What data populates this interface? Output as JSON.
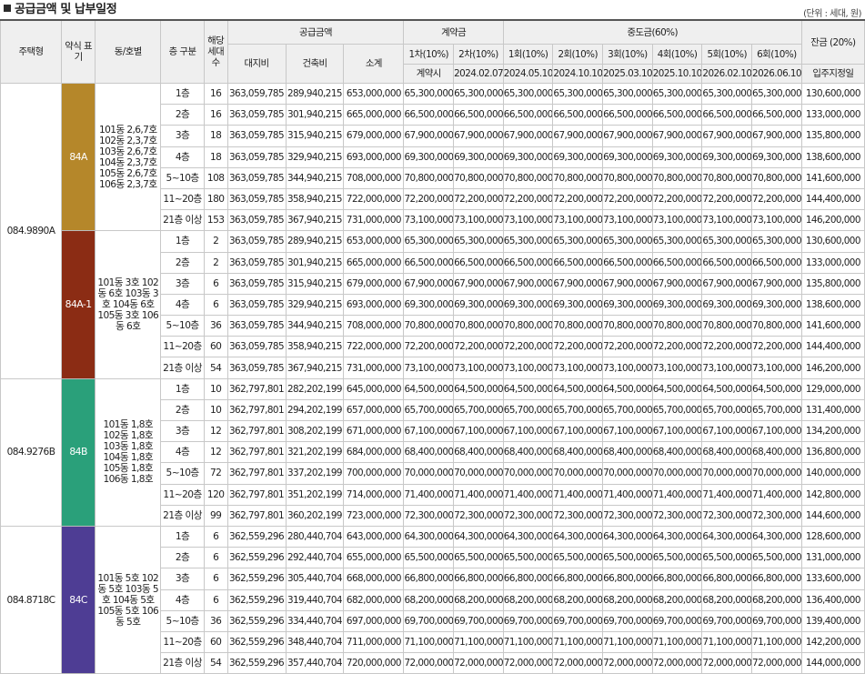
{
  "title": "공급금액 및 납부일정",
  "unit": "(단위 : 세대, 원)",
  "headers": {
    "type": "주택형",
    "abbr": "약식 표기",
    "dong": "동/호별",
    "floor": "층 구분",
    "units": "해당 세대수",
    "supply": "공급금액",
    "land": "대지비",
    "building": "건축비",
    "subtotal": "소계",
    "contract": "계약금",
    "c1": "1차(10%)",
    "c2": "2차(10%)",
    "c1_date": "계약시",
    "c2_date": "2024.02.07",
    "middle": "중도금(60%)",
    "m_labels": [
      "1회(10%)",
      "2회(10%)",
      "3회(10%)",
      "4회(10%)",
      "5회(10%)",
      "6회(10%)"
    ],
    "m_dates": [
      "2024.05.10",
      "2024.10.10",
      "2025.03.10",
      "2025.10.10",
      "2026.02.10",
      "2026.06.10"
    ],
    "balance": "잔금 (20%)",
    "balance_date": "입주지정일"
  },
  "groups": [
    {
      "type": "084.9890A",
      "abbr": "84A",
      "color": "#b5872a",
      "dong": "101동 2,6,7호 102동 2,3,7호 103동 2,6,7호 104동 2,3,7호 105동 2,6,7호 106동 2,3,7호",
      "rows": [
        {
          "floor": "1층",
          "units": "16",
          "land": "363,059,785",
          "building": "289,940,215",
          "subtotal": "653,000,000",
          "c1": "65,300,000",
          "c2": "65,300,000",
          "m": [
            "65,300,000",
            "65,300,000",
            "65,300,000",
            "65,300,000",
            "65,300,000",
            "65,300,000"
          ],
          "balance": "130,600,000"
        },
        {
          "floor": "2층",
          "units": "16",
          "land": "363,059,785",
          "building": "301,940,215",
          "subtotal": "665,000,000",
          "c1": "66,500,000",
          "c2": "66,500,000",
          "m": [
            "66,500,000",
            "66,500,000",
            "66,500,000",
            "66,500,000",
            "66,500,000",
            "66,500,000"
          ],
          "balance": "133,000,000"
        },
        {
          "floor": "3층",
          "units": "18",
          "land": "363,059,785",
          "building": "315,940,215",
          "subtotal": "679,000,000",
          "c1": "67,900,000",
          "c2": "67,900,000",
          "m": [
            "67,900,000",
            "67,900,000",
            "67,900,000",
            "67,900,000",
            "67,900,000",
            "67,900,000"
          ],
          "balance": "135,800,000"
        },
        {
          "floor": "4층",
          "units": "18",
          "land": "363,059,785",
          "building": "329,940,215",
          "subtotal": "693,000,000",
          "c1": "69,300,000",
          "c2": "69,300,000",
          "m": [
            "69,300,000",
            "69,300,000",
            "69,300,000",
            "69,300,000",
            "69,300,000",
            "69,300,000"
          ],
          "balance": "138,600,000"
        },
        {
          "floor": "5~10층",
          "units": "108",
          "land": "363,059,785",
          "building": "344,940,215",
          "subtotal": "708,000,000",
          "c1": "70,800,000",
          "c2": "70,800,000",
          "m": [
            "70,800,000",
            "70,800,000",
            "70,800,000",
            "70,800,000",
            "70,800,000",
            "70,800,000"
          ],
          "balance": "141,600,000"
        },
        {
          "floor": "11~20층",
          "units": "180",
          "land": "363,059,785",
          "building": "358,940,215",
          "subtotal": "722,000,000",
          "c1": "72,200,000",
          "c2": "72,200,000",
          "m": [
            "72,200,000",
            "72,200,000",
            "72,200,000",
            "72,200,000",
            "72,200,000",
            "72,200,000"
          ],
          "balance": "144,400,000"
        },
        {
          "floor": "21층 이상",
          "units": "153",
          "land": "363,059,785",
          "building": "367,940,215",
          "subtotal": "731,000,000",
          "c1": "73,100,000",
          "c2": "73,100,000",
          "m": [
            "73,100,000",
            "73,100,000",
            "73,100,000",
            "73,100,000",
            "73,100,000",
            "73,100,000"
          ],
          "balance": "146,200,000"
        }
      ]
    },
    {
      "type": "",
      "abbr": "84A-1",
      "color": "#8b2c14",
      "dong": "101동 3호 102동 6호 103동 3호 104동 6호 105동 3호 106동 6호",
      "rows": [
        {
          "floor": "1층",
          "units": "2",
          "land": "363,059,785",
          "building": "289,940,215",
          "subtotal": "653,000,000",
          "c1": "65,300,000",
          "c2": "65,300,000",
          "m": [
            "65,300,000",
            "65,300,000",
            "65,300,000",
            "65,300,000",
            "65,300,000",
            "65,300,000"
          ],
          "balance": "130,600,000"
        },
        {
          "floor": "2층",
          "units": "2",
          "land": "363,059,785",
          "building": "301,940,215",
          "subtotal": "665,000,000",
          "c1": "66,500,000",
          "c2": "66,500,000",
          "m": [
            "66,500,000",
            "66,500,000",
            "66,500,000",
            "66,500,000",
            "66,500,000",
            "66,500,000"
          ],
          "balance": "133,000,000"
        },
        {
          "floor": "3층",
          "units": "6",
          "land": "363,059,785",
          "building": "315,940,215",
          "subtotal": "679,000,000",
          "c1": "67,900,000",
          "c2": "67,900,000",
          "m": [
            "67,900,000",
            "67,900,000",
            "67,900,000",
            "67,900,000",
            "67,900,000",
            "67,900,000"
          ],
          "balance": "135,800,000"
        },
        {
          "floor": "4층",
          "units": "6",
          "land": "363,059,785",
          "building": "329,940,215",
          "subtotal": "693,000,000",
          "c1": "69,300,000",
          "c2": "69,300,000",
          "m": [
            "69,300,000",
            "69,300,000",
            "69,300,000",
            "69,300,000",
            "69,300,000",
            "69,300,000"
          ],
          "balance": "138,600,000"
        },
        {
          "floor": "5~10층",
          "units": "36",
          "land": "363,059,785",
          "building": "344,940,215",
          "subtotal": "708,000,000",
          "c1": "70,800,000",
          "c2": "70,800,000",
          "m": [
            "70,800,000",
            "70,800,000",
            "70,800,000",
            "70,800,000",
            "70,800,000",
            "70,800,000"
          ],
          "balance": "141,600,000"
        },
        {
          "floor": "11~20층",
          "units": "60",
          "land": "363,059,785",
          "building": "358,940,215",
          "subtotal": "722,000,000",
          "c1": "72,200,000",
          "c2": "72,200,000",
          "m": [
            "72,200,000",
            "72,200,000",
            "72,200,000",
            "72,200,000",
            "72,200,000",
            "72,200,000"
          ],
          "balance": "144,400,000"
        },
        {
          "floor": "21층 이상",
          "units": "54",
          "land": "363,059,785",
          "building": "367,940,215",
          "subtotal": "731,000,000",
          "c1": "73,100,000",
          "c2": "73,100,000",
          "m": [
            "73,100,000",
            "73,100,000",
            "73,100,000",
            "73,100,000",
            "73,100,000",
            "73,100,000"
          ],
          "balance": "146,200,000"
        }
      ]
    },
    {
      "type": "084.9276B",
      "abbr": "84B",
      "color": "#2aa07a",
      "dong": "101동 1,8호 102동 1,8호 103동 1,8호 104동 1,8호 105동 1,8호 106동 1,8호",
      "rows": [
        {
          "floor": "1층",
          "units": "10",
          "land": "362,797,801",
          "building": "282,202,199",
          "subtotal": "645,000,000",
          "c1": "64,500,000",
          "c2": "64,500,000",
          "m": [
            "64,500,000",
            "64,500,000",
            "64,500,000",
            "64,500,000",
            "64,500,000",
            "64,500,000"
          ],
          "balance": "129,000,000"
        },
        {
          "floor": "2층",
          "units": "10",
          "land": "362,797,801",
          "building": "294,202,199",
          "subtotal": "657,000,000",
          "c1": "65,700,000",
          "c2": "65,700,000",
          "m": [
            "65,700,000",
            "65,700,000",
            "65,700,000",
            "65,700,000",
            "65,700,000",
            "65,700,000"
          ],
          "balance": "131,400,000"
        },
        {
          "floor": "3층",
          "units": "12",
          "land": "362,797,801",
          "building": "308,202,199",
          "subtotal": "671,000,000",
          "c1": "67,100,000",
          "c2": "67,100,000",
          "m": [
            "67,100,000",
            "67,100,000",
            "67,100,000",
            "67,100,000",
            "67,100,000",
            "67,100,000"
          ],
          "balance": "134,200,000"
        },
        {
          "floor": "4층",
          "units": "12",
          "land": "362,797,801",
          "building": "321,202,199",
          "subtotal": "684,000,000",
          "c1": "68,400,000",
          "c2": "68,400,000",
          "m": [
            "68,400,000",
            "68,400,000",
            "68,400,000",
            "68,400,000",
            "68,400,000",
            "68,400,000"
          ],
          "balance": "136,800,000"
        },
        {
          "floor": "5~10층",
          "units": "72",
          "land": "362,797,801",
          "building": "337,202,199",
          "subtotal": "700,000,000",
          "c1": "70,000,000",
          "c2": "70,000,000",
          "m": [
            "70,000,000",
            "70,000,000",
            "70,000,000",
            "70,000,000",
            "70,000,000",
            "70,000,000"
          ],
          "balance": "140,000,000"
        },
        {
          "floor": "11~20층",
          "units": "120",
          "land": "362,797,801",
          "building": "351,202,199",
          "subtotal": "714,000,000",
          "c1": "71,400,000",
          "c2": "71,400,000",
          "m": [
            "71,400,000",
            "71,400,000",
            "71,400,000",
            "71,400,000",
            "71,400,000",
            "71,400,000"
          ],
          "balance": "142,800,000"
        },
        {
          "floor": "21층 이상",
          "units": "99",
          "land": "362,797,801",
          "building": "360,202,199",
          "subtotal": "723,000,000",
          "c1": "72,300,000",
          "c2": "72,300,000",
          "m": [
            "72,300,000",
            "72,300,000",
            "72,300,000",
            "72,300,000",
            "72,300,000",
            "72,300,000"
          ],
          "balance": "144,600,000"
        }
      ]
    },
    {
      "type": "084.8718C",
      "abbr": "84C",
      "color": "#4e3d94",
      "dong": "101동 5호 102동 5호 103동 5호 104동 5호 105동 5호 106동 5호",
      "rows": [
        {
          "floor": "1층",
          "units": "6",
          "land": "362,559,296",
          "building": "280,440,704",
          "subtotal": "643,000,000",
          "c1": "64,300,000",
          "c2": "64,300,000",
          "m": [
            "64,300,000",
            "64,300,000",
            "64,300,000",
            "64,300,000",
            "64,300,000",
            "64,300,000"
          ],
          "balance": "128,600,000"
        },
        {
          "floor": "2층",
          "units": "6",
          "land": "362,559,296",
          "building": "292,440,704",
          "subtotal": "655,000,000",
          "c1": "65,500,000",
          "c2": "65,500,000",
          "m": [
            "65,500,000",
            "65,500,000",
            "65,500,000",
            "65,500,000",
            "65,500,000",
            "65,500,000"
          ],
          "balance": "131,000,000"
        },
        {
          "floor": "3층",
          "units": "6",
          "land": "362,559,296",
          "building": "305,440,704",
          "subtotal": "668,000,000",
          "c1": "66,800,000",
          "c2": "66,800,000",
          "m": [
            "66,800,000",
            "66,800,000",
            "66,800,000",
            "66,800,000",
            "66,800,000",
            "66,800,000"
          ],
          "balance": "133,600,000"
        },
        {
          "floor": "4층",
          "units": "6",
          "land": "362,559,296",
          "building": "319,440,704",
          "subtotal": "682,000,000",
          "c1": "68,200,000",
          "c2": "68,200,000",
          "m": [
            "68,200,000",
            "68,200,000",
            "68,200,000",
            "68,200,000",
            "68,200,000",
            "68,200,000"
          ],
          "balance": "136,400,000"
        },
        {
          "floor": "5~10층",
          "units": "36",
          "land": "362,559,296",
          "building": "334,440,704",
          "subtotal": "697,000,000",
          "c1": "69,700,000",
          "c2": "69,700,000",
          "m": [
            "69,700,000",
            "69,700,000",
            "69,700,000",
            "69,700,000",
            "69,700,000",
            "69,700,000"
          ],
          "balance": "139,400,000"
        },
        {
          "floor": "11~20층",
          "units": "60",
          "land": "362,559,296",
          "building": "348,440,704",
          "subtotal": "711,000,000",
          "c1": "71,100,000",
          "c2": "71,100,000",
          "m": [
            "71,100,000",
            "71,100,000",
            "71,100,000",
            "71,100,000",
            "71,100,000",
            "71,100,000"
          ],
          "balance": "142,200,000"
        },
        {
          "floor": "21층 이상",
          "units": "54",
          "land": "362,559,296",
          "building": "357,440,704",
          "subtotal": "720,000,000",
          "c1": "72,000,000",
          "c2": "72,000,000",
          "m": [
            "72,000,000",
            "72,000,000",
            "72,000,000",
            "72,000,000",
            "72,000,000",
            "72,000,000"
          ],
          "balance": "144,000,000"
        }
      ]
    }
  ]
}
